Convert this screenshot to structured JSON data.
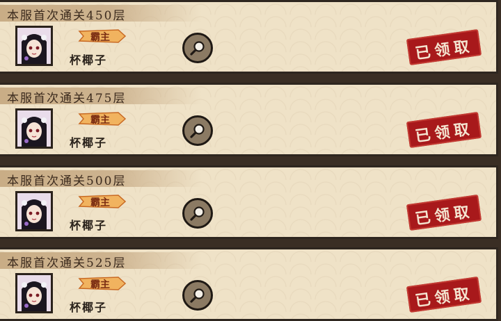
{
  "records": [
    {
      "title": "本服首次通关450层",
      "badge": "霸主",
      "name": "杯椰子",
      "status": "已领取"
    },
    {
      "title": "本服首次通关475层",
      "badge": "霸主",
      "name": "杯椰子",
      "status": "已领取"
    },
    {
      "title": "本服首次通关500层",
      "badge": "霸主",
      "name": "杯椰子",
      "status": "已领取"
    },
    {
      "title": "本服首次通关525层",
      "badge": "霸主",
      "name": "杯椰子",
      "status": "已领取"
    }
  ],
  "icons": {
    "search": "magnifier-icon",
    "avatar": "character-portrait",
    "badge": "title-ribbon"
  },
  "colors": {
    "card_bg": "#efe2c7",
    "stamp_red": "#a8191b",
    "border": "#2e261f",
    "button": "#8b7a63"
  }
}
